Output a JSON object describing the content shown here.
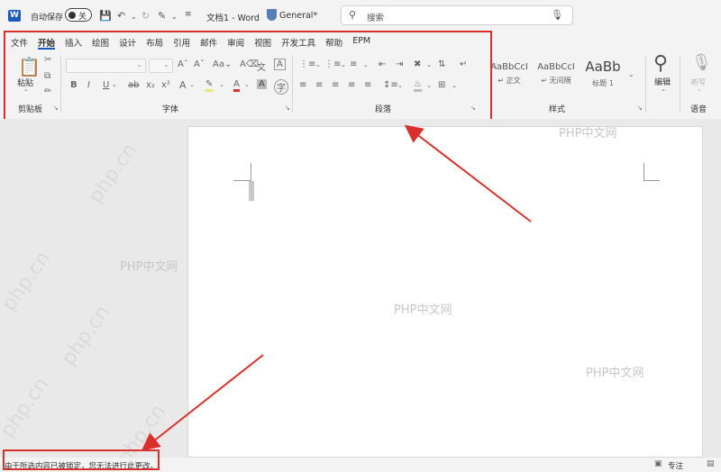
{
  "titlebar": {
    "app_icon": "word-logo-icon",
    "autosave_label": "自动保存",
    "autosave_state": "关",
    "doc_title": "文档1 - Word",
    "sensitivity": "General*",
    "search_placeholder": "搜索"
  },
  "tabs": [
    "文件",
    "开始",
    "插入",
    "绘图",
    "设计",
    "布局",
    "引用",
    "邮件",
    "审阅",
    "视图",
    "开发工具",
    "帮助",
    "EPM"
  ],
  "active_tab": "开始",
  "ribbon": {
    "clipboard": {
      "paste_label": "粘贴",
      "group_label": "剪贴板"
    },
    "font": {
      "group_label": "字体"
    },
    "paragraph": {
      "group_label": "段落"
    },
    "styles": {
      "group_label": "样式",
      "items": [
        {
          "sample": "AaBbCcI",
          "name": "↵ 正文"
        },
        {
          "sample": "AaBbCcI",
          "name": "↵ 无间隔"
        },
        {
          "sample": "AaBb",
          "name": "标题 1"
        }
      ]
    },
    "editing": {
      "label": "编辑"
    },
    "voice": {
      "dictate_label": "听写",
      "group_label": "语音"
    }
  },
  "watermarks": [
    "PHP中文网",
    "PHP中文网",
    "PHP中文网",
    "PHP中文网"
  ],
  "watermarks_diag": [
    "php.cn",
    "php.cn",
    "php.cn",
    "php.cn",
    "php.cn"
  ],
  "statusbar": {
    "message": "由于所选内容已被锁定，您无法进行此更改。",
    "focus_label": "专注"
  },
  "colors": {
    "accent": "#185abd",
    "highlight_box": "#d9302c"
  }
}
